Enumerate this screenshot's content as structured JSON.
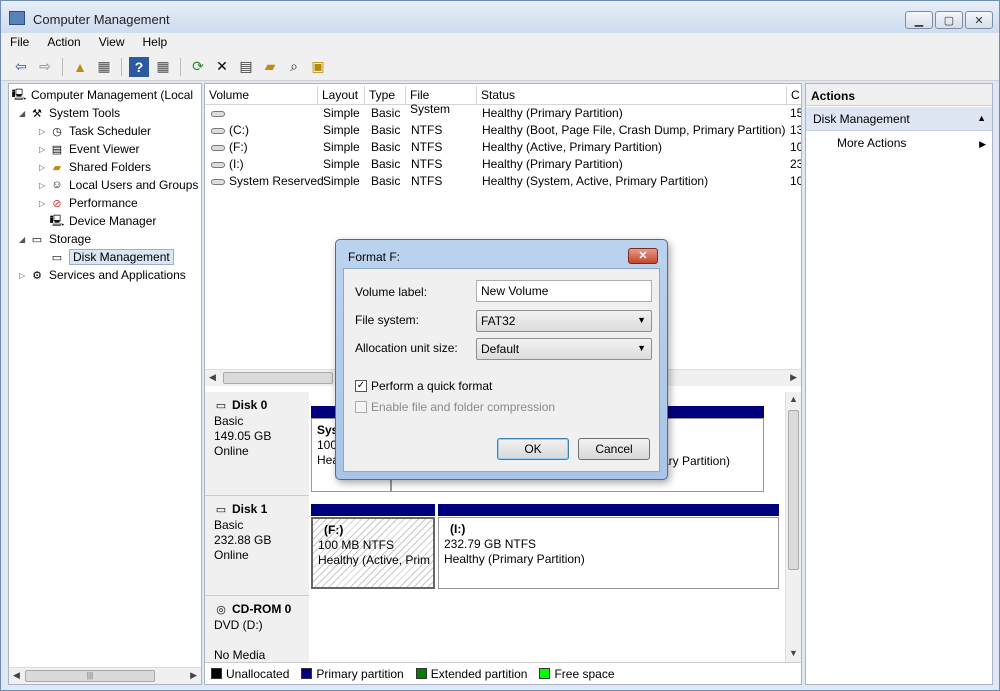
{
  "window": {
    "title": "Computer Management"
  },
  "menu": [
    "File",
    "Action",
    "View",
    "Help"
  ],
  "tree": {
    "root": "Computer Management (Local",
    "system_tools": "System Tools",
    "task_scheduler": "Task Scheduler",
    "event_viewer": "Event Viewer",
    "shared_folders": "Shared Folders",
    "local_users": "Local Users and Groups",
    "performance": "Performance",
    "device_manager": "Device Manager",
    "storage": "Storage",
    "disk_management": "Disk Management",
    "services": "Services and Applications"
  },
  "volumes": {
    "headers": [
      "Volume",
      "Layout",
      "Type",
      "File System",
      "Status",
      "C"
    ],
    "rows": [
      [
        "",
        "Simple",
        "Basic",
        "",
        "Healthy (Primary Partition)",
        "15"
      ],
      [
        "(C:)",
        "Simple",
        "Basic",
        "NTFS",
        "Healthy (Boot, Page File, Crash Dump, Primary Partition)",
        "13"
      ],
      [
        "(F:)",
        "Simple",
        "Basic",
        "NTFS",
        "Healthy (Active, Primary Partition)",
        "10"
      ],
      [
        "(I:)",
        "Simple",
        "Basic",
        "NTFS",
        "Healthy (Primary Partition)",
        "23"
      ],
      [
        "System Reserved",
        "Simple",
        "Basic",
        "NTFS",
        "Healthy (System, Active, Primary Partition)",
        "10"
      ]
    ]
  },
  "disks": {
    "disk0": {
      "name": "Disk 0",
      "type": "Basic",
      "size": "149.05 GB",
      "state": "Online",
      "p1_name": "Sys",
      "p1_size": "100",
      "p1_status": "Hea",
      "p2_status": "mary Partition)"
    },
    "disk1": {
      "name": "Disk 1",
      "type": "Basic",
      "size": "232.88 GB",
      "state": "Online",
      "p1_name": "(F:)",
      "p1_size": "100 MB NTFS",
      "p1_status": "Healthy (Active, Prim",
      "p2_name": "(I:)",
      "p2_size": "232.79 GB NTFS",
      "p2_status": "Healthy (Primary Partition)"
    },
    "cdrom": {
      "name": "CD-ROM 0",
      "drive": "DVD (D:)",
      "media": "No Media"
    }
  },
  "legend": [
    {
      "label": "Unallocated",
      "color": "#000000"
    },
    {
      "label": "Primary partition",
      "color": "#00007f"
    },
    {
      "label": "Extended partition",
      "color": "#007f00"
    },
    {
      "label": "Free space",
      "color": "#00ff00"
    }
  ],
  "actions": {
    "header": "Actions",
    "section": "Disk Management",
    "more": "More Actions"
  },
  "dialog": {
    "title": "Format F:",
    "close_label": "✕",
    "volume_label_caption": "Volume label:",
    "volume_label_value": "New Volume",
    "file_system_caption": "File system:",
    "file_system_value": "FAT32",
    "alloc_caption": "Allocation unit size:",
    "alloc_value": "Default",
    "quick_format": "Perform a quick format",
    "quick_format_checked": true,
    "compression": "Enable file and folder compression",
    "compression_checked": false,
    "ok": "OK",
    "cancel": "Cancel"
  }
}
